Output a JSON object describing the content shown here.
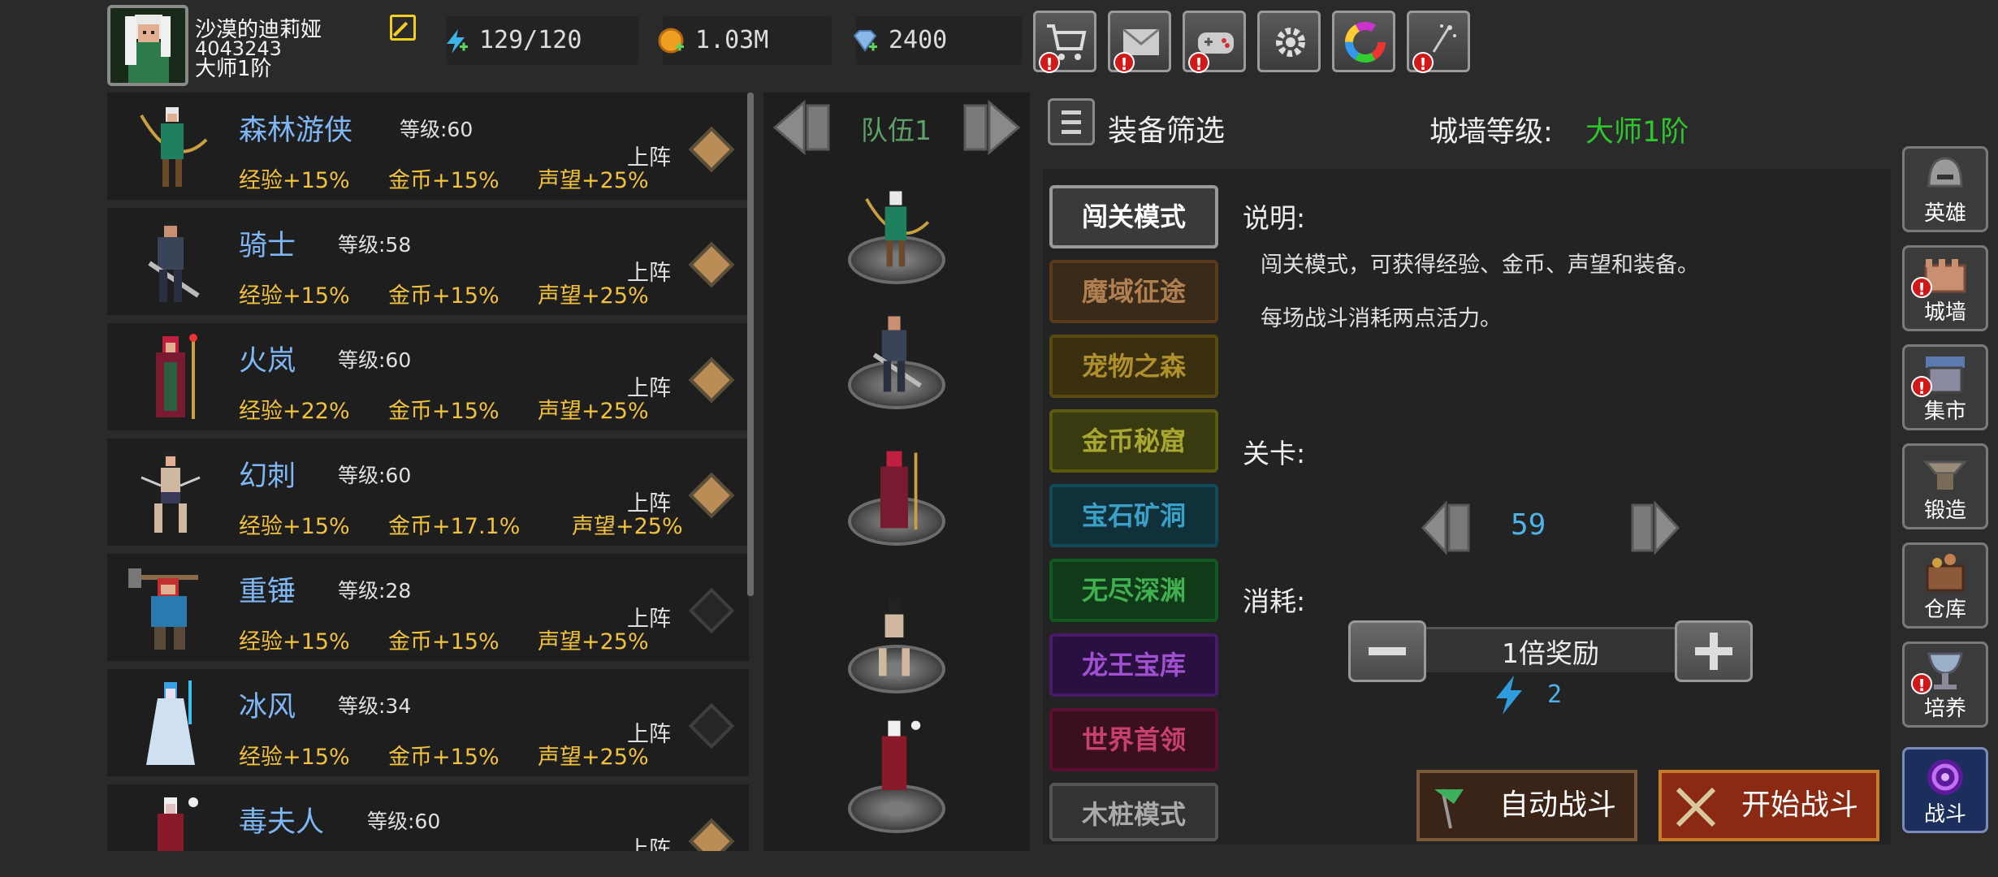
{
  "player": {
    "name": "沙漠的迪莉娅",
    "id": "4043243",
    "rank": "大师1阶"
  },
  "resources": {
    "energy": "129/120",
    "gold": "1.03M",
    "gems": "2400"
  },
  "top_buttons": [
    {
      "name": "shop",
      "alert": "!"
    },
    {
      "name": "mail",
      "alert": "!"
    },
    {
      "name": "gamepad",
      "alert": "!"
    },
    {
      "name": "settings",
      "alert": ""
    },
    {
      "name": "color",
      "alert": ""
    },
    {
      "name": "effects",
      "alert": "!"
    }
  ],
  "heroes": [
    {
      "name": "森林游侠",
      "level_label": "等级:60",
      "exp": "经验+15%",
      "gold": "金币+15%",
      "fame": "声望+25%",
      "deploy": "上阵",
      "deployed": true
    },
    {
      "name": "骑士",
      "level_label": "等级:58",
      "exp": "经验+15%",
      "gold": "金币+15%",
      "fame": "声望+25%",
      "deploy": "上阵",
      "deployed": true
    },
    {
      "name": "火岚",
      "level_label": "等级:60",
      "exp": "经验+22%",
      "gold": "金币+15%",
      "fame": "声望+25%",
      "deploy": "上阵",
      "deployed": true
    },
    {
      "name": "幻刺",
      "level_label": "等级:60",
      "exp": "经验+15%",
      "gold": "金币+17.1%",
      "fame": "声望+25%",
      "deploy": "上阵",
      "deployed": true
    },
    {
      "name": "重锤",
      "level_label": "等级:28",
      "exp": "经验+15%",
      "gold": "金币+15%",
      "fame": "声望+25%",
      "deploy": "上阵",
      "deployed": false
    },
    {
      "name": "冰风",
      "level_label": "等级:34",
      "exp": "经验+15%",
      "gold": "金币+15%",
      "fame": "声望+25%",
      "deploy": "上阵",
      "deployed": false
    },
    {
      "name": "毒夫人",
      "level_label": "等级:60",
      "exp": "",
      "gold": "",
      "fame": "",
      "deploy": "上阵",
      "deployed": true
    }
  ],
  "team": {
    "label": "队伍1"
  },
  "filter": {
    "label": "装备筛选"
  },
  "wall": {
    "label": "城墙等级:",
    "value": "大师1阶"
  },
  "modes": [
    {
      "label": "闯关模式",
      "selected": true
    },
    {
      "label": "魔域征途"
    },
    {
      "label": "宠物之森"
    },
    {
      "label": "金币秘窟"
    },
    {
      "label": "宝石矿洞"
    },
    {
      "label": "无尽深渊"
    },
    {
      "label": "龙王宝库"
    },
    {
      "label": "世界首领"
    },
    {
      "label": "木桩模式"
    }
  ],
  "details": {
    "desc_label": "说明:",
    "desc_line1": "闯关模式，可获得经验、金币、声望和装备。",
    "desc_line2": "每场战斗消耗两点活力。",
    "stage_label": "关卡:",
    "stage_value": "59",
    "cost_label": "消耗:",
    "multiplier": "1倍奖励",
    "cost_value": "2"
  },
  "actions": {
    "auto_battle": "自动战斗",
    "start_battle": "开始战斗"
  },
  "nav": [
    {
      "label": "英雄",
      "alert": ""
    },
    {
      "label": "城墙",
      "alert": "!"
    },
    {
      "label": "集市",
      "alert": "!"
    },
    {
      "label": "锻造",
      "alert": ""
    },
    {
      "label": "仓库",
      "alert": ""
    },
    {
      "label": "培养",
      "alert": "!"
    },
    {
      "label": "战斗",
      "alert": ""
    }
  ],
  "colors": {
    "hero_name": "#7fb7f5",
    "bonus": "#f2c23c",
    "wall_value": "#2ec52e",
    "team_label": "#5fa06a",
    "stage_value": "#4eb4e8"
  }
}
